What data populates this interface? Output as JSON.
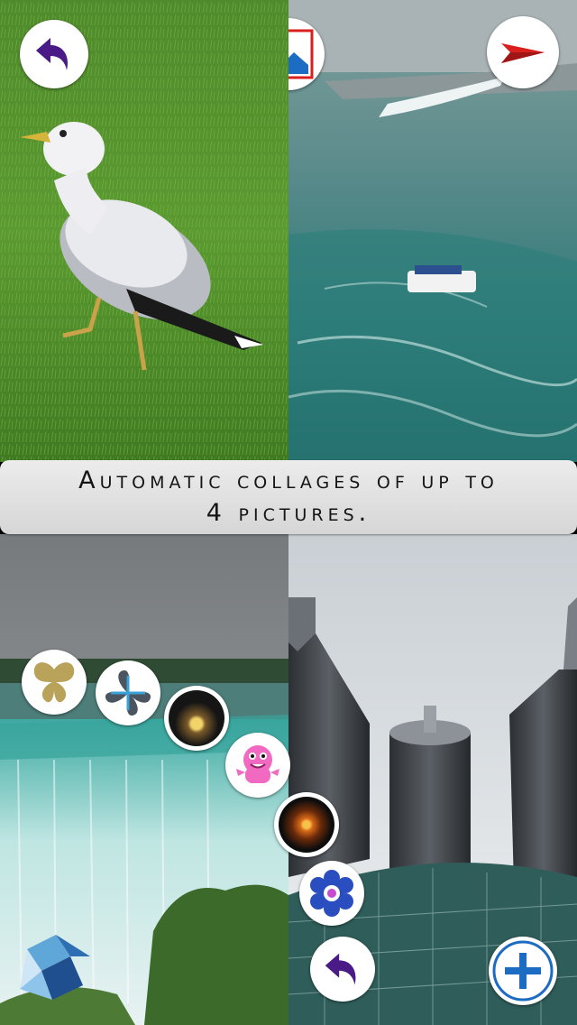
{
  "caption": {
    "line1": "Automatic collages of up to",
    "line2": "4 pictures."
  },
  "toolbar": {
    "back_icon": "undo-arrow-icon",
    "gallery_icon": "landscape-photo-icon",
    "send_icon": "paper-plane-send-icon"
  },
  "photos": [
    {
      "position": "top-left",
      "subject": "seagull-on-grass"
    },
    {
      "position": "top-right",
      "subject": "waterfall-with-boat"
    },
    {
      "position": "bottom-left",
      "subject": "horseshoe-waterfall"
    },
    {
      "position": "bottom-right",
      "subject": "skyscraper-towers"
    }
  ],
  "sticker_menu": [
    {
      "icon": "butterfly-icon"
    },
    {
      "icon": "flower-petals-icon"
    },
    {
      "icon": "sunset-icon"
    },
    {
      "icon": "pink-monster-icon"
    },
    {
      "icon": "fireworks-icon"
    },
    {
      "icon": "blue-flower-icon"
    }
  ],
  "bottom_bar": {
    "logo_icon": "app-logo-icon",
    "undo_icon": "undo-arrow-icon",
    "add_icon": "plus-icon"
  },
  "colors": {
    "accent_purple": "#4a1a86",
    "accent_red": "#d9201f",
    "accent_blue": "#1d6cc4",
    "caption_bg": "#e3e3e3"
  }
}
